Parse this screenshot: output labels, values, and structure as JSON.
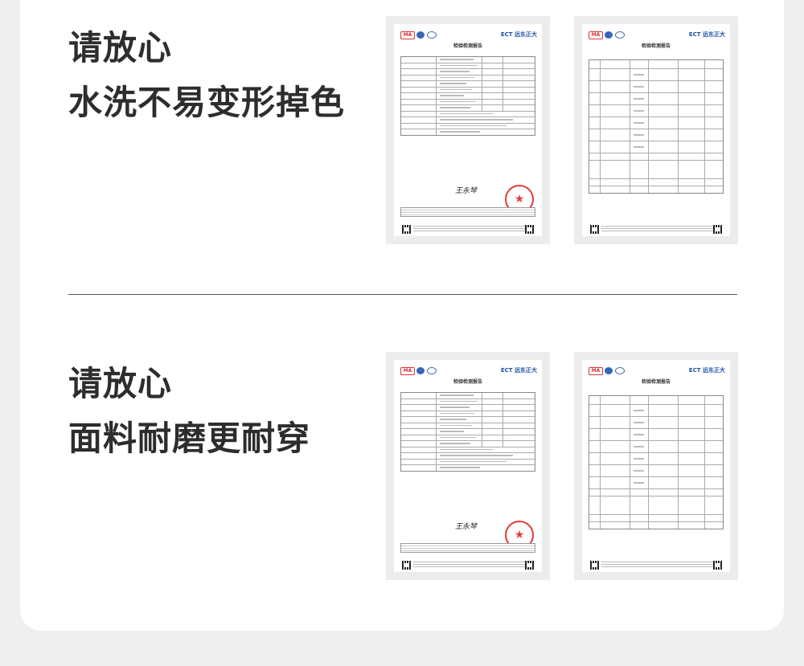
{
  "sections": [
    {
      "line1": "请放心",
      "line2": "水洗不易变形掉色"
    },
    {
      "line1": "请放心",
      "line2": "面料耐磨更耐穿"
    }
  ],
  "report": {
    "brand": "ECT 远东正大",
    "title": "检验检测报告",
    "ma_mark": "MA",
    "signature": "王永琴"
  },
  "colors": {
    "heading": "#2d2d2d",
    "stamp": "#e23a3a",
    "brand_blue": "#1b4fa8",
    "page_bg": "#efefef",
    "card_bg": "#ffffff"
  }
}
